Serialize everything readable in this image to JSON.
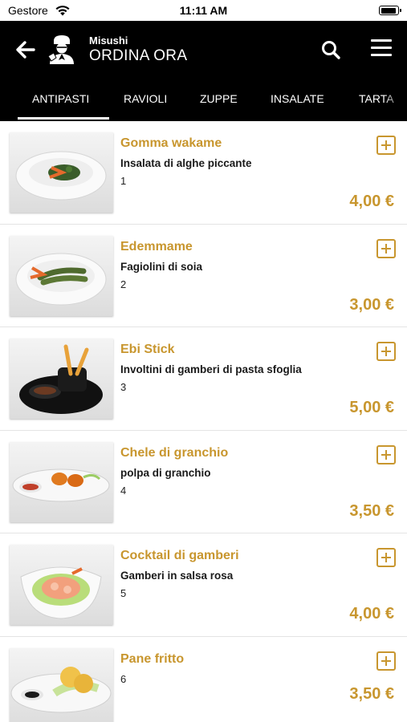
{
  "status_bar": {
    "carrier": "Gestore",
    "time": "11:11 AM"
  },
  "header": {
    "app_name": "Misushi",
    "title": "ORDINA ORA",
    "icons": {
      "back": "arrow-left-icon",
      "logo": "chef-logo",
      "search": "search-icon",
      "menu": "hamburger-menu-icon"
    }
  },
  "tabs": [
    {
      "label": "ANTIPASTI",
      "active": true
    },
    {
      "label": "RAVIOLI",
      "active": false
    },
    {
      "label": "ZUPPE",
      "active": false
    },
    {
      "label": "INSALATE",
      "active": false
    },
    {
      "label": "TARTA",
      "active": false
    }
  ],
  "items": [
    {
      "name": "Gomma wakame",
      "description": "Insalata di alghe piccante",
      "code": "1",
      "price": "4,00 €"
    },
    {
      "name": "Edemmame",
      "description": "Fagiolini di soia",
      "code": "2",
      "price": "3,00 €"
    },
    {
      "name": "Ebi Stick",
      "description": "Involtini di gamberi di pasta sfoglia",
      "code": "3",
      "price": "5,00 €"
    },
    {
      "name": "Chele di granchio",
      "description": "polpa di granchio",
      "code": "4",
      "price": "3,50 €"
    },
    {
      "name": "Cocktail di gamberi",
      "description": "Gamberi in salsa rosa",
      "code": "5",
      "price": "4,00 €"
    },
    {
      "name": "Pane fritto",
      "description": "",
      "code": "6",
      "price": "3,50 €"
    }
  ],
  "colors": {
    "accent": "#c8962e",
    "header_bg": "#000000",
    "text": "#1a1a1a"
  }
}
